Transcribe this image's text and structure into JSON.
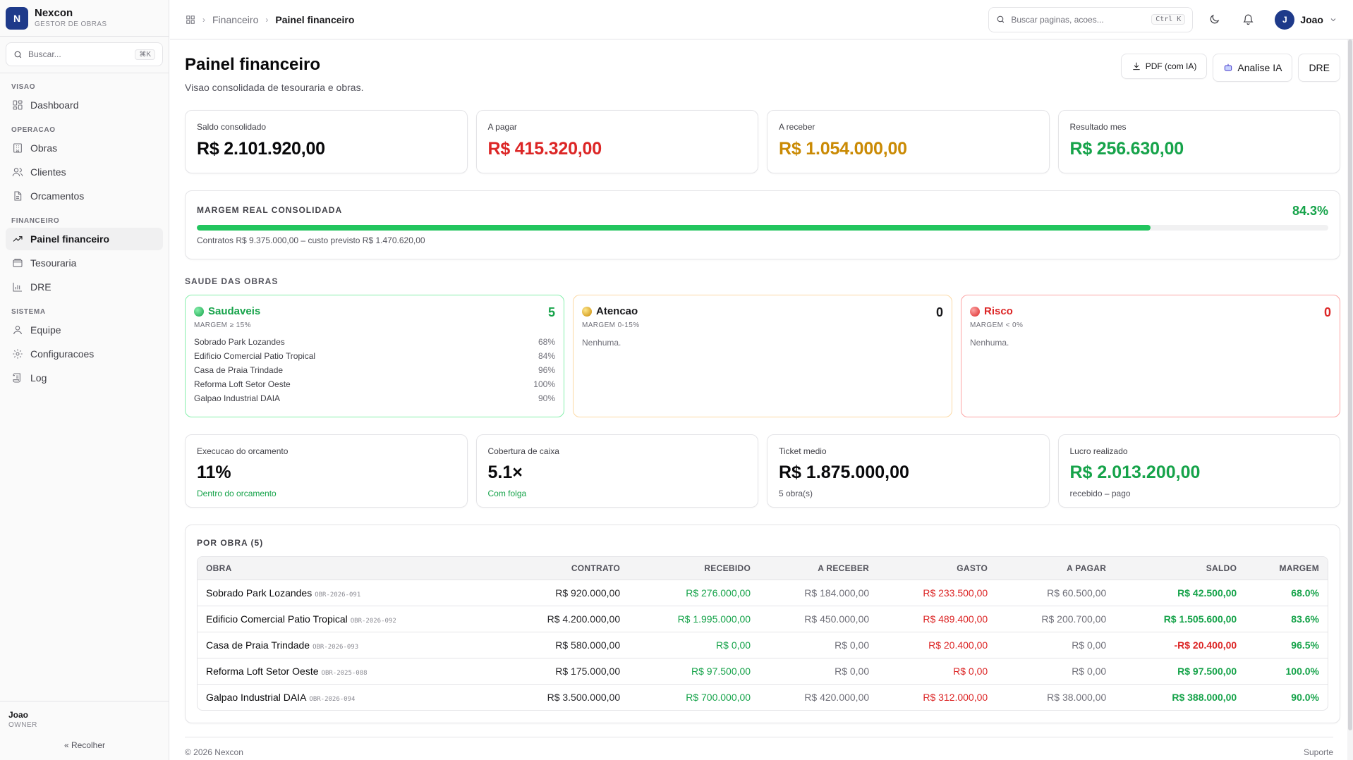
{
  "brand": {
    "logo_letter": "N",
    "name": "Nexcon",
    "subtitle": "GESTOR DE OBRAS",
    "accent": "#1e3a8a"
  },
  "sidebar": {
    "search_placeholder": "Buscar...",
    "search_shortcut": "⌘K",
    "groups": [
      {
        "title": "VISAO",
        "items": [
          {
            "label": "Dashboard",
            "icon": "dashboard-icon"
          }
        ]
      },
      {
        "title": "OPERACAO",
        "items": [
          {
            "label": "Obras",
            "icon": "building-icon"
          },
          {
            "label": "Clientes",
            "icon": "users-icon"
          },
          {
            "label": "Orcamentos",
            "icon": "document-icon"
          }
        ]
      },
      {
        "title": "FINANCEIRO",
        "items": [
          {
            "label": "Painel financeiro",
            "icon": "trend-icon",
            "active": true
          },
          {
            "label": "Tesouraria",
            "icon": "wallet-icon"
          },
          {
            "label": "DRE",
            "icon": "bar-chart-icon"
          }
        ]
      },
      {
        "title": "SISTEMA",
        "items": [
          {
            "label": "Equipe",
            "icon": "user-icon"
          },
          {
            "label": "Configuracoes",
            "icon": "gear-icon"
          },
          {
            "label": "Log",
            "icon": "scroll-icon"
          }
        ]
      }
    ],
    "user_name": "Joao",
    "user_role": "OWNER",
    "collapse_label": "Recolher"
  },
  "topbar": {
    "breadcrumb": [
      "Financeiro",
      "Painel financeiro"
    ],
    "search_placeholder": "Buscar paginas, acoes...",
    "search_shortcut": "Ctrl K",
    "user_initial": "J",
    "user_name": "Joao"
  },
  "page": {
    "title": "Painel financeiro",
    "subtitle": "Visao consolidada de tesouraria e obras.",
    "actions": {
      "pdf": "PDF (com IA)",
      "ai": "Analise IA",
      "dre": "DRE"
    }
  },
  "kpis": [
    {
      "label": "Saldo consolidado",
      "value": "R$ 2.101.920,00",
      "color": "#09090b"
    },
    {
      "label": "A pagar",
      "value": "R$ 415.320,00",
      "color": "#dc2626"
    },
    {
      "label": "A receber",
      "value": "R$ 1.054.000,00",
      "color": "#ca8a04"
    },
    {
      "label": "Resultado mes",
      "value": "R$ 256.630,00",
      "color": "#16a34a"
    }
  ],
  "margin": {
    "title": "MARGEM REAL CONSOLIDADA",
    "percent_label": "84.3%",
    "percent": 84.3,
    "note": "Contratos R$ 9.375.000,00 – custo previsto R$ 1.470.620,00"
  },
  "health": {
    "title": "SAUDE DAS OBRAS",
    "cards": [
      {
        "label": "Saudaveis",
        "count": "5",
        "sub": "MARGEM ≥ 15%",
        "dot": "#22c55e",
        "items": [
          {
            "name": "Sobrado Park Lozandes",
            "pct": "68%"
          },
          {
            "name": "Edificio Comercial Patio Tropical",
            "pct": "84%"
          },
          {
            "name": "Casa de Praia Trindade",
            "pct": "96%"
          },
          {
            "name": "Reforma Loft Setor Oeste",
            "pct": "100%"
          },
          {
            "name": "Galpao Industrial DAIA",
            "pct": "90%"
          }
        ]
      },
      {
        "label": "Atencao",
        "count": "0",
        "sub": "MARGEM 0-15%",
        "dot": "#eab308",
        "empty": "Nenhuma."
      },
      {
        "label": "Risco",
        "count": "0",
        "sub": "MARGEM < 0%",
        "dot": "#ef4444",
        "empty": "Nenhuma."
      }
    ]
  },
  "stats": [
    {
      "label": "Execucao do orcamento",
      "value": "11%",
      "note": "Dentro do orcamento",
      "note_color": "#16a34a"
    },
    {
      "label": "Cobertura de caixa",
      "value": "5.1×",
      "note": "Com folga",
      "note_color": "#16a34a"
    },
    {
      "label": "Ticket medio",
      "value": "R$ 1.875.000,00",
      "note": "5 obra(s)",
      "note_color": "#52525b"
    },
    {
      "label": "Lucro realizado",
      "value": "R$ 2.013.200,00",
      "note": "recebido – pago",
      "note_color": "#52525b",
      "value_color": "#16a34a"
    }
  ],
  "obras": {
    "title": "POR OBRA (5)",
    "columns": [
      "OBRA",
      "CONTRATO",
      "RECEBIDO",
      "A RECEBER",
      "GASTO",
      "A PAGAR",
      "SALDO",
      "MARGEM"
    ],
    "rows": [
      {
        "name": "Sobrado Park Lozandes",
        "code": "OBR-2026-091",
        "contrato": "R$ 920.000,00",
        "recebido": "R$ 276.000,00",
        "a_receber": "R$ 184.000,00",
        "gasto": "R$ 233.500,00",
        "a_pagar": "R$ 60.500,00",
        "saldo": "R$ 42.500,00",
        "saldo_neg": false,
        "margem": "68.0%"
      },
      {
        "name": "Edificio Comercial Patio Tropical",
        "code": "OBR-2026-092",
        "contrato": "R$ 4.200.000,00",
        "recebido": "R$ 1.995.000,00",
        "a_receber": "R$ 450.000,00",
        "gasto": "R$ 489.400,00",
        "a_pagar": "R$ 200.700,00",
        "saldo": "R$ 1.505.600,00",
        "saldo_neg": false,
        "margem": "83.6%"
      },
      {
        "name": "Casa de Praia Trindade",
        "code": "OBR-2026-093",
        "contrato": "R$ 580.000,00",
        "recebido": "R$ 0,00",
        "a_receber": "R$ 0,00",
        "gasto": "R$ 20.400,00",
        "a_pagar": "R$ 0,00",
        "saldo": "-R$ 20.400,00",
        "saldo_neg": true,
        "margem": "96.5%"
      },
      {
        "name": "Reforma Loft Setor Oeste",
        "code": "OBR-2025-088",
        "contrato": "R$ 175.000,00",
        "recebido": "R$ 97.500,00",
        "a_receber": "R$ 0,00",
        "gasto": "R$ 0,00",
        "a_pagar": "R$ 0,00",
        "saldo": "R$ 97.500,00",
        "saldo_neg": false,
        "margem": "100.0%"
      },
      {
        "name": "Galpao Industrial DAIA",
        "code": "OBR-2026-094",
        "contrato": "R$ 3.500.000,00",
        "recebido": "R$ 700.000,00",
        "a_receber": "R$ 420.000,00",
        "gasto": "R$ 312.000,00",
        "a_pagar": "R$ 38.000,00",
        "saldo": "R$ 388.000,00",
        "saldo_neg": false,
        "margem": "90.0%"
      }
    ]
  },
  "footer": {
    "copyright": "© 2026 Nexcon",
    "support": "Suporte"
  }
}
